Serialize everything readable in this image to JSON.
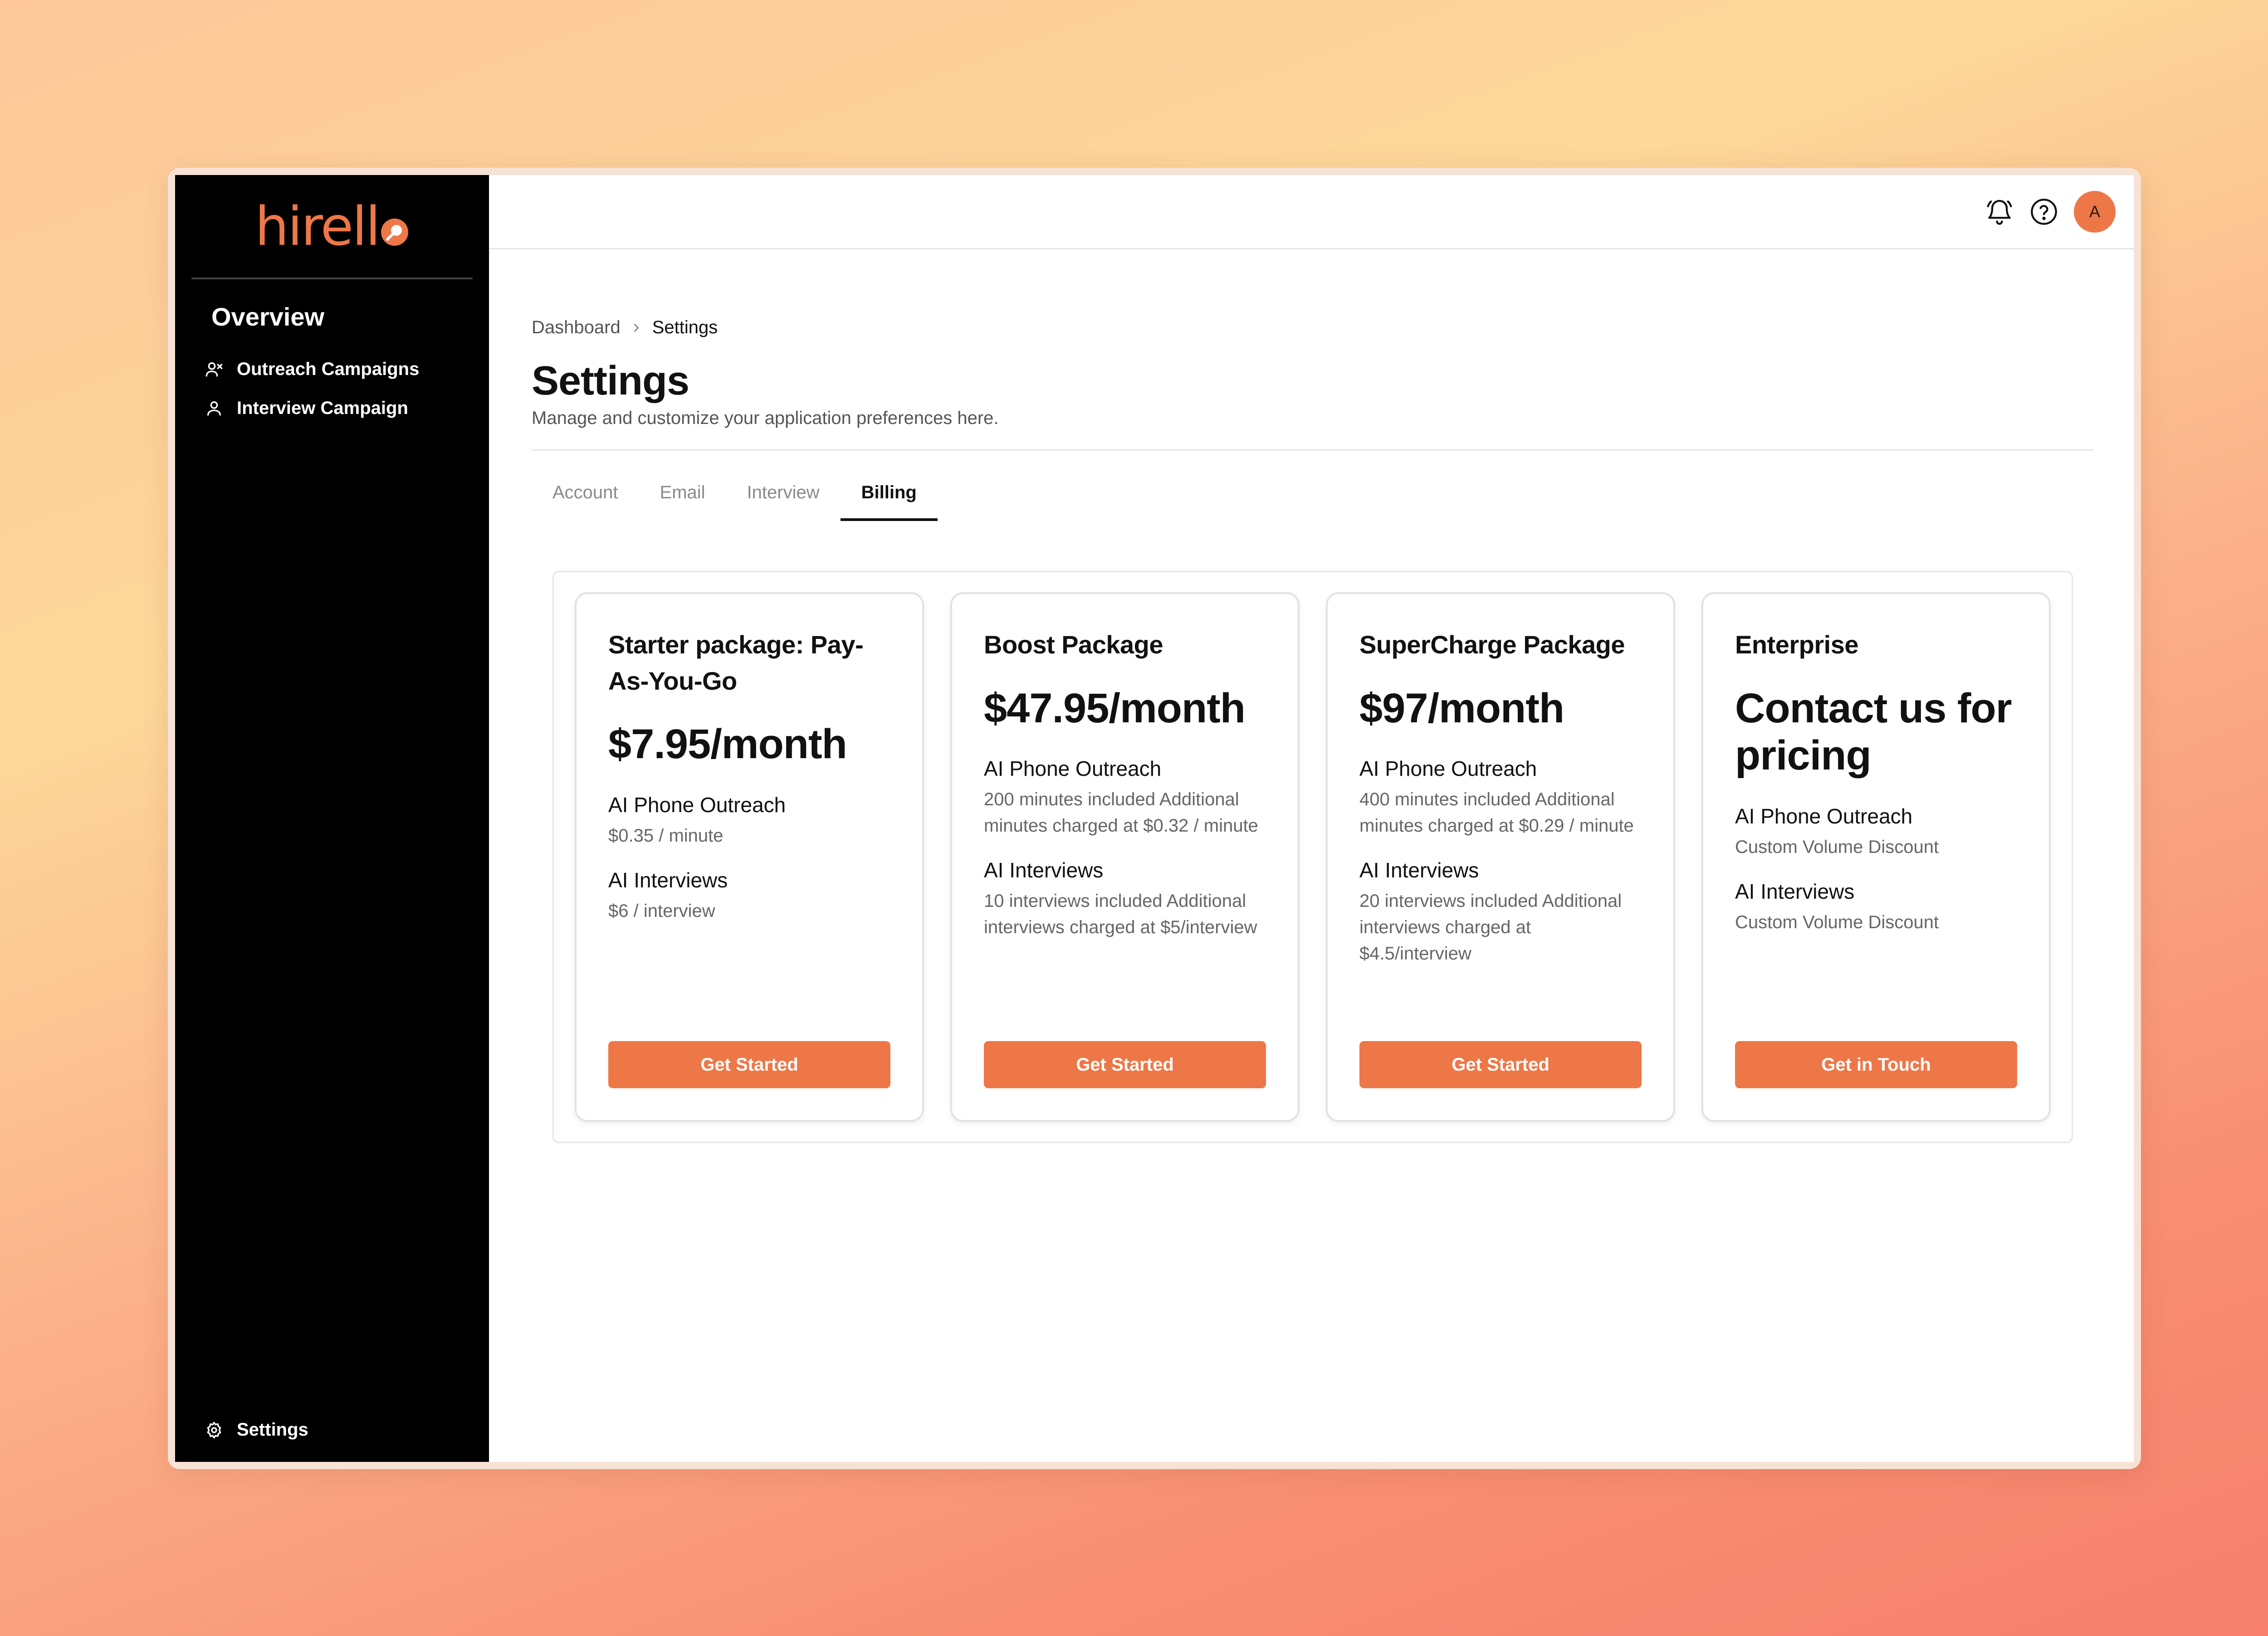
{
  "brand": {
    "name": "hirell",
    "accent": "#ee7748"
  },
  "sidebar": {
    "section_title": "Overview",
    "items": [
      {
        "label": "Outreach Campaigns",
        "icon": "users-outreach-icon"
      },
      {
        "label": "Interview Campaign",
        "icon": "user-icon"
      }
    ],
    "settings_label": "Settings"
  },
  "topbar": {
    "avatar_initial": "A"
  },
  "breadcrumb": {
    "parent": "Dashboard",
    "current": "Settings"
  },
  "page": {
    "title": "Settings",
    "subtitle": "Manage and customize your application preferences here."
  },
  "tabs": [
    {
      "label": "Account",
      "active": false
    },
    {
      "label": "Email",
      "active": false
    },
    {
      "label": "Interview",
      "active": false
    },
    {
      "label": "Billing",
      "active": true
    }
  ],
  "plans": [
    {
      "name": "Starter package: Pay-As-You-Go",
      "price": "$7.95/month",
      "feature1_title": "AI Phone Outreach",
      "feature1_detail": "$0.35 / minute",
      "feature2_title": "AI Interviews",
      "feature2_detail": "$6 / interview",
      "cta": "Get Started"
    },
    {
      "name": "Boost Package",
      "price": "$47.95/month",
      "feature1_title": "AI Phone Outreach",
      "feature1_detail": "200 minutes included Additional minutes charged at $0.32 / minute",
      "feature2_title": "AI Interviews",
      "feature2_detail": "10 interviews included Additional interviews charged at $5/interview",
      "cta": "Get Started"
    },
    {
      "name": "SuperCharge Package",
      "price": "$97/month",
      "feature1_title": "AI Phone Outreach",
      "feature1_detail": "400 minutes included Additional minutes charged at $0.29 / minute",
      "feature2_title": "AI Interviews",
      "feature2_detail": "20 interviews included Additional interviews charged at $4.5/interview",
      "cta": "Get Started"
    },
    {
      "name": "Enterprise",
      "price": "Contact us for pricing",
      "feature1_title": "AI Phone Outreach",
      "feature1_detail": "Custom Volume Discount",
      "feature2_title": "AI Interviews",
      "feature2_detail": "Custom Volume Discount",
      "cta": "Get in Touch"
    }
  ]
}
